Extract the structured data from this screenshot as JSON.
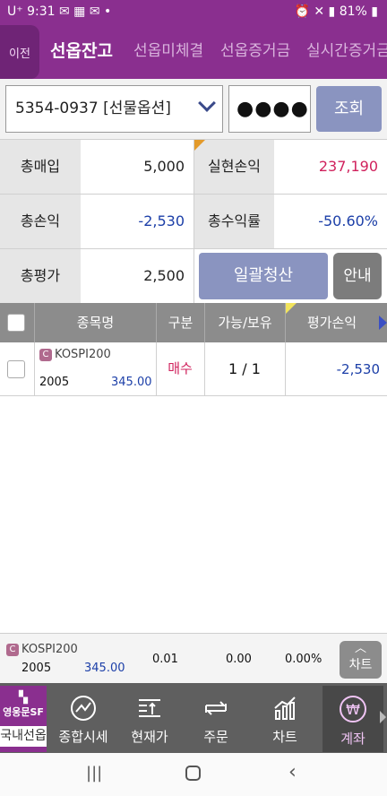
{
  "status": {
    "carrier": "U⁺",
    "time": "9:31",
    "right": "81%"
  },
  "tabs": {
    "back": "이전",
    "items": [
      "선옵잔고",
      "선옵미체결",
      "선옵증거금",
      "실시간증거금"
    ]
  },
  "account": {
    "number_label": "5354-0937 [선물옵션]",
    "password_mask": "●●●●",
    "query_label": "조회"
  },
  "summary": {
    "total_buy_label": "총매입",
    "total_buy": "5,000",
    "realized_label": "실현손익",
    "realized": "237,190",
    "total_pl_label": "총손익",
    "total_pl": "-2,530",
    "total_rate_label": "총수익률",
    "total_rate": "-50.60%",
    "total_eval_label": "총평가",
    "total_eval": "2,500",
    "liquidate_label": "일괄청산",
    "guide_label": "안내"
  },
  "table": {
    "headers": [
      "종목명",
      "구분",
      "가능/보유",
      "평가손익"
    ],
    "rows": [
      {
        "badge": "C",
        "name": "KOSPI200",
        "code": "2005",
        "strike": "345.00",
        "side": "매수",
        "qty": "1 / 1",
        "pl": "-2,530"
      }
    ]
  },
  "ticker": {
    "badge": "C",
    "name": "KOSPI200",
    "code": "2005",
    "strike": "345.00",
    "price": "0.01",
    "change": "0.00",
    "rate": "0.00%",
    "chart_label": "차트"
  },
  "bottom_nav": {
    "items": [
      {
        "label": "국내선옵",
        "sub": "영웅문SF"
      },
      {
        "label": "종합시세"
      },
      {
        "label": "현재가"
      },
      {
        "label": "주문"
      },
      {
        "label": "차트"
      },
      {
        "label": "계좌"
      }
    ]
  },
  "colors": {
    "brand": "#8a2f8f",
    "up": "#d0215c",
    "down": "#1c3fa8"
  }
}
